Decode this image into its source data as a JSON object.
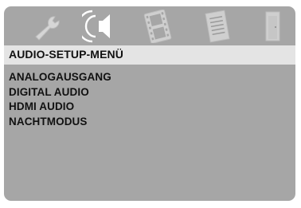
{
  "icons": [
    {
      "name": "wrench-icon",
      "label": "General Setup",
      "active": false
    },
    {
      "name": "speaker-icon",
      "label": "Audio Setup",
      "active": true
    },
    {
      "name": "film-icon",
      "label": "Video Setup",
      "active": false
    },
    {
      "name": "list-icon",
      "label": "Preferences",
      "active": false
    },
    {
      "name": "door-icon",
      "label": "Exit",
      "active": false
    }
  ],
  "menu": {
    "title": "AUDIO-SETUP-MENÜ",
    "items": [
      "ANALOGAUSGANG",
      "DIGITAL AUDIO",
      "HDMI AUDIO",
      "NACHTMODUS"
    ]
  },
  "colors": {
    "panel": "#a6a6a6",
    "title_bar": "#e4e4e4",
    "active_icon": "#ffffff",
    "inactive_icon": "#d6d6d6",
    "text": "#111111"
  }
}
